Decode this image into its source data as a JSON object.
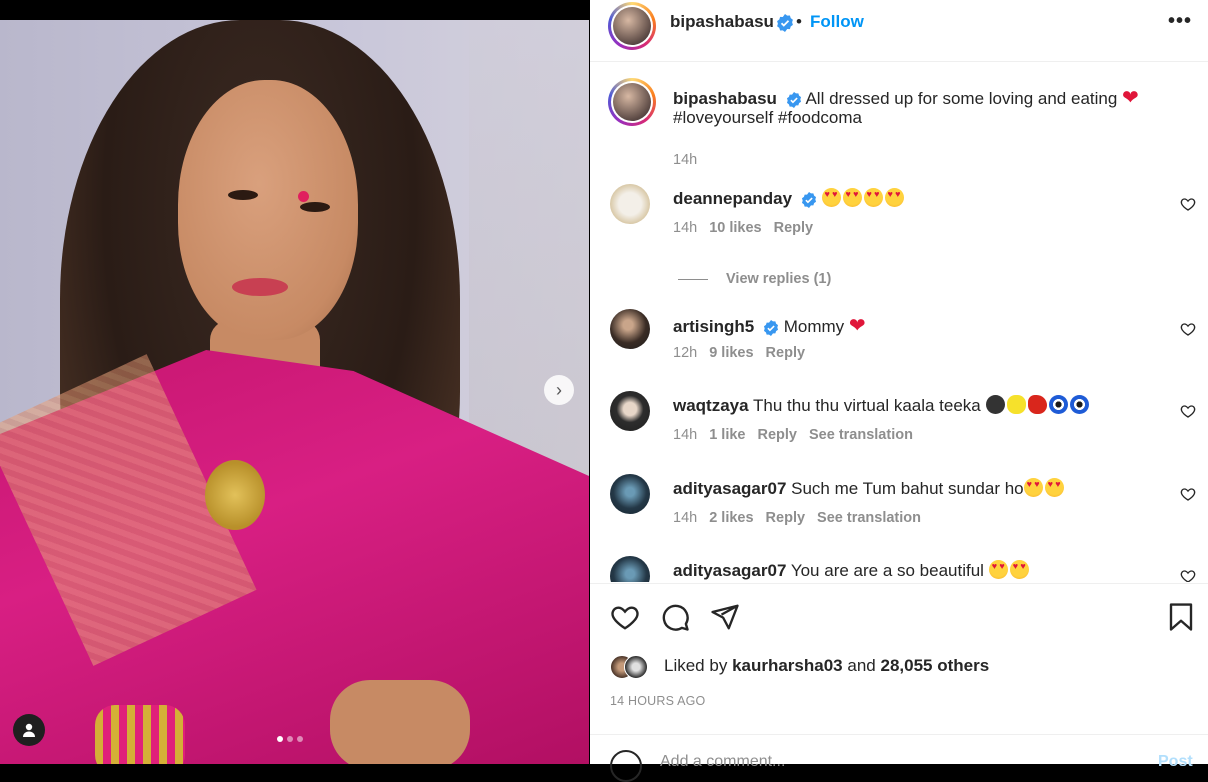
{
  "header": {
    "username": "bipashabasu",
    "separator": "•",
    "follow_label": "Follow",
    "more_label": "•••"
  },
  "caption": {
    "username": "bipashabasu",
    "text": "All dressed up for some loving and eating",
    "hashtags": "#loveyourself #foodcoma",
    "time": "14h"
  },
  "comments": [
    {
      "username": "deannepanday",
      "verified": true,
      "text": "",
      "emojis": [
        "love",
        "love",
        "love",
        "love"
      ],
      "time": "14h",
      "likes": "10 likes",
      "reply": "Reply",
      "translate": ""
    },
    {
      "username": "artisingh5",
      "verified": true,
      "text": "Mommy",
      "emojis": [
        "heart"
      ],
      "time": "12h",
      "likes": "9 likes",
      "reply": "Reply",
      "translate": ""
    },
    {
      "username": "waqtzaya",
      "verified": false,
      "text": "Thu thu thu virtual kaala teeka",
      "emojis": [
        "black",
        "lemon",
        "chili",
        "eye",
        "eye"
      ],
      "time": "14h",
      "likes": "1 like",
      "reply": "Reply",
      "translate": "See translation"
    },
    {
      "username": "adityasagar07",
      "verified": false,
      "text": "Such me Tum bahut sundar ho",
      "emojis": [
        "love",
        "love"
      ],
      "time": "14h",
      "likes": "2 likes",
      "reply": "Reply",
      "translate": "See translation"
    },
    {
      "username": "adityasagar07",
      "verified": false,
      "text": "You are are a so beautiful",
      "emojis": [
        "love",
        "love"
      ],
      "time": "",
      "likes": "",
      "reply": "",
      "translate": ""
    }
  ],
  "view_replies": "View replies (1)",
  "actions": {
    "liked_prefix": "Liked by",
    "liked_user": "kaurharsha03",
    "liked_and": "and",
    "liked_others": "28,055 others",
    "time_ago": "14 HOURS AGO",
    "comment_placeholder": "Add a comment...",
    "post_label": "Post"
  },
  "colors": {
    "accent": "#0095f6",
    "hashtag": "#00376b",
    "muted": "#8e8e8e",
    "saree": "#d81f83"
  }
}
